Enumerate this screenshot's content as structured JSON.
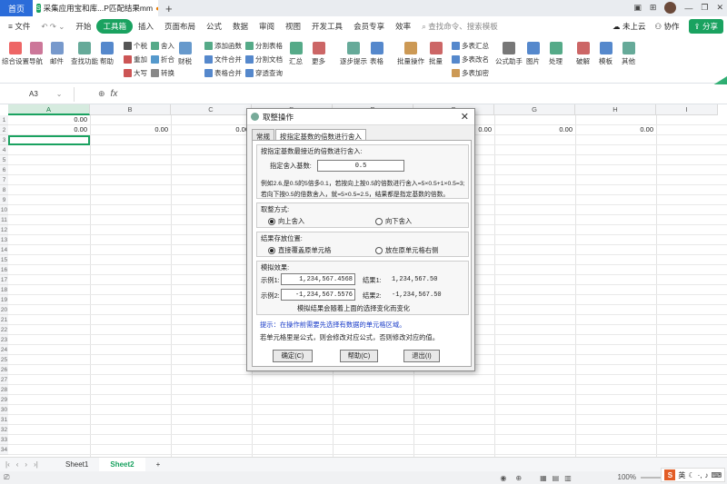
{
  "titlebar": {
    "home_tab": "首页",
    "doc_tab": "采集应用宝和库...P匹配结果mm",
    "new_tab": "+"
  },
  "menubar": {
    "file": "≡ 文件",
    "items": [
      "开始",
      "工具箱",
      "插入",
      "页面布局",
      "公式",
      "数据",
      "审阅",
      "视图",
      "开发工具",
      "会员专享",
      "效率"
    ],
    "search": "查找命令、搜索模板",
    "cloud": "未上云",
    "collab": "协作",
    "share": "分享"
  },
  "ribbon": {
    "big": [
      "综合设置",
      "导航",
      "邮件",
      "查找功能",
      "帮助",
      "财税",
      "汇总",
      "更多",
      "逐步提示",
      "表格",
      "批量操作",
      "批量",
      "公式助手",
      "图片",
      "处理",
      "破解",
      "模板",
      "其他"
    ],
    "small": [
      "个税",
      "重加",
      "大写",
      "舍入",
      "折合",
      "转换",
      "添加函数",
      "文件合并",
      "表格合并",
      "分割表格",
      "分割文档",
      "穿透查询",
      "多表汇总",
      "多表改名",
      "多表加密"
    ]
  },
  "formulabar": {
    "cell_ref": "A3",
    "fx": "fx"
  },
  "grid": {
    "columns": [
      "A",
      "B",
      "C",
      "D",
      "E",
      "F",
      "G",
      "H",
      "I"
    ],
    "rows": [
      "1",
      "2",
      "3",
      "4",
      "5",
      "6",
      "7",
      "8",
      "9",
      "10",
      "11",
      "12",
      "13",
      "14",
      "15",
      "16",
      "17",
      "18",
      "19",
      "20",
      "21",
      "22",
      "23",
      "24",
      "25",
      "26",
      "27",
      "28",
      "29",
      "30",
      "31",
      "32",
      "33",
      "34"
    ],
    "row1": [
      "0.00"
    ],
    "row2": [
      "0.00",
      "0.00",
      "0.00",
      "0.00",
      "0.00",
      "0.00",
      "0.00"
    ]
  },
  "sheets": {
    "tabs": [
      "Sheet1",
      "Sheet2"
    ],
    "active": "Sheet2",
    "add": "+"
  },
  "status": {
    "zoom": "100%"
  },
  "ime": {
    "logo": "S",
    "lang": "英"
  },
  "dialog": {
    "title": "取整操作",
    "tabs": [
      "常规",
      "按指定基数的倍数进行舍入"
    ],
    "section1_title": "按指定基数最接近的倍数进行舍入:",
    "base_label": "指定舍入基数:",
    "base_value": "0.5",
    "example_line1": "例如2.6,是0.5的5倍多0.1，若按向上按0.5的倍数进行舍入=5×0.5+1×0.5=3;",
    "example_line2": "若向下按0.5的倍数舍入，就=5×0.5=2.5，结果都是指定基数的倍数。",
    "method_title": "取整方式:",
    "method_up": "向上舍入",
    "method_down": "向下舍入",
    "store_title": "结果存放位置:",
    "store_overwrite": "直接覆盖原单元格",
    "store_right": "放在原单元格右侧",
    "sim_title": "模拟效果:",
    "ex1_label": "示例1:",
    "ex1_value": "1,234,567.4568",
    "res1_label": "结果1:",
    "res1_value": "1,234,567.50",
    "ex2_label": "示例2:",
    "ex2_value": "-1,234,567.5576",
    "res2_label": "结果2:",
    "res2_value": "-1,234,567.50",
    "sim_note": "模拟结果会随着上面的选择变化而变化",
    "tip": "提示：在操作前需要先选择有数据的单元格区域。",
    "note": "若单元格里是公式，则会修改对应公式，否则修改对应的值。",
    "ok": "确定(C)",
    "help": "帮助(C)",
    "exit": "退出(I)",
    "close": "✕"
  }
}
